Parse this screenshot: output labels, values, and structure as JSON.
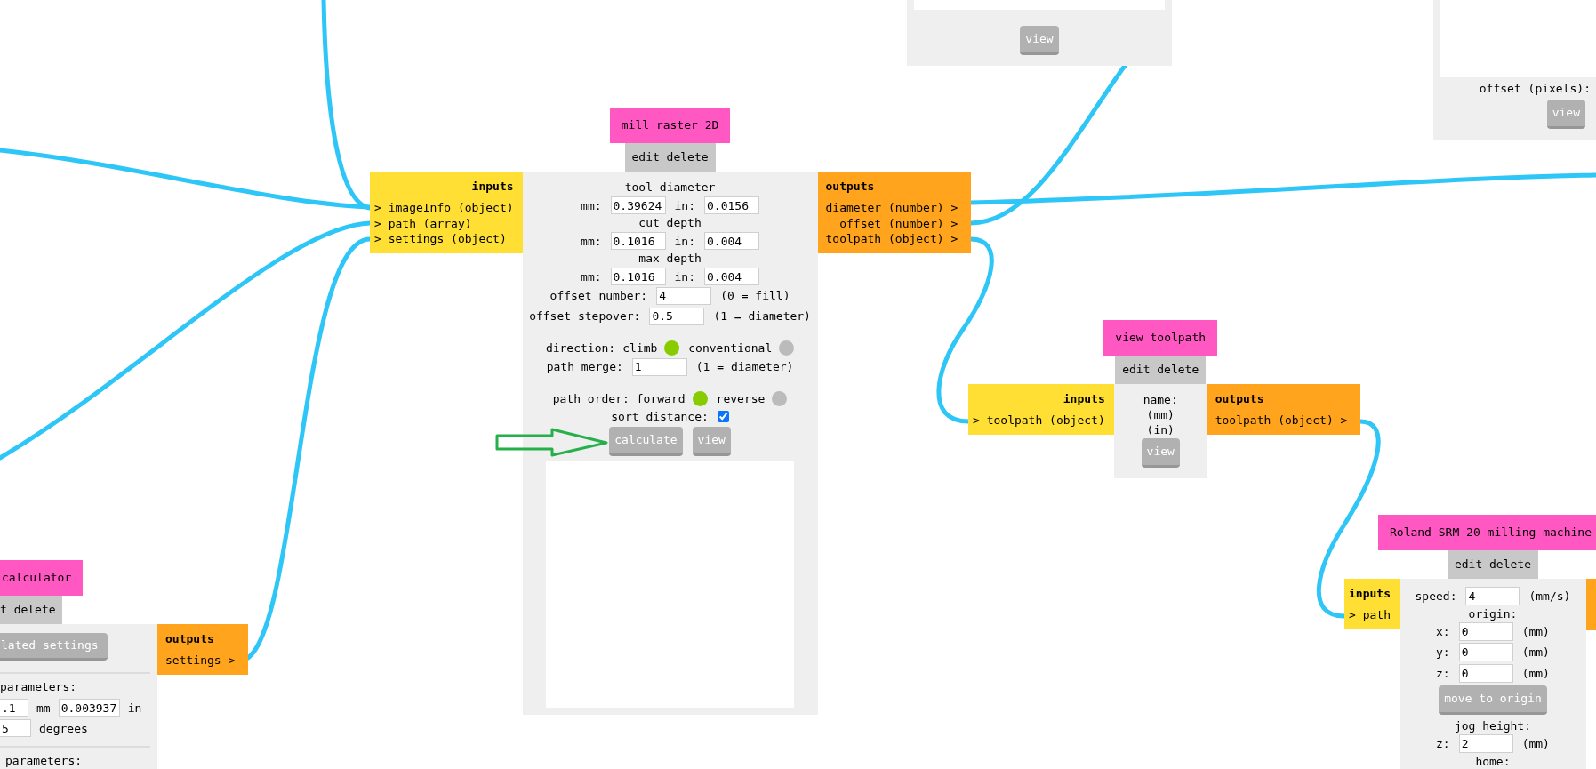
{
  "top_preview_node": {
    "buttons": [
      "view"
    ]
  },
  "offset_node": {
    "label": "offset (pixels):",
    "buttons": [
      "view"
    ]
  },
  "mill_raster_node": {
    "title": "mill raster 2D",
    "menu": [
      "edit",
      "delete"
    ],
    "inputs": {
      "title": "inputs",
      "ports": [
        "> imageInfo (object)",
        "> path (array)",
        "> settings (object)"
      ]
    },
    "outputs": {
      "title": "outputs",
      "ports": [
        "diameter (number) >",
        "offset (number) >",
        "toolpath (object) >"
      ]
    },
    "params": [
      {
        "kind": "heading",
        "text": "tool diameter"
      },
      {
        "kind": "pair",
        "fields": [
          {
            "label": "mm:",
            "value": "0.39624"
          },
          {
            "label": "in:",
            "value": "0.0156"
          }
        ]
      },
      {
        "kind": "heading",
        "text": "cut depth"
      },
      {
        "kind": "pair",
        "fields": [
          {
            "label": "mm:",
            "value": "0.1016"
          },
          {
            "label": "in:",
            "value": "0.004"
          }
        ]
      },
      {
        "kind": "heading",
        "text": "max depth"
      },
      {
        "kind": "pair",
        "fields": [
          {
            "label": "mm:",
            "value": "0.1016"
          },
          {
            "label": "in:",
            "value": "0.004"
          }
        ]
      },
      {
        "kind": "field",
        "label": "offset number:",
        "value": "4",
        "unit": "(0 = fill)"
      },
      {
        "kind": "field",
        "label": "offset stepover:",
        "value": "0.5",
        "unit": "(1 = diameter)"
      },
      {
        "kind": "radio",
        "label": "direction:",
        "options": [
          {
            "label": "climb",
            "selected": true
          },
          {
            "label": "conventional",
            "selected": false
          }
        ]
      },
      {
        "kind": "field",
        "label": "path merge:",
        "value": "1",
        "unit": "(1 = diameter)"
      },
      {
        "kind": "radio",
        "label": "path order:",
        "options": [
          {
            "label": "forward",
            "selected": true
          },
          {
            "label": "reverse",
            "selected": false
          }
        ]
      },
      {
        "kind": "checkbox",
        "label": "sort distance:",
        "checked": true
      }
    ],
    "buttons": [
      "calculate",
      "view"
    ]
  },
  "view_toolpath_node": {
    "title": "view toolpath",
    "menu": [
      "edit",
      "delete"
    ],
    "inputs": {
      "title": "inputs",
      "ports": [
        "> toolpath (object)"
      ]
    },
    "outputs": {
      "title": "outputs",
      "ports": [
        "toolpath (object) >"
      ]
    },
    "params": [
      {
        "kind": "heading",
        "text": "name:"
      },
      {
        "kind": "heading",
        "text": "(mm)"
      },
      {
        "kind": "heading",
        "text": "(in)"
      }
    ],
    "buttons": [
      "view"
    ]
  },
  "roland_node": {
    "title": "Roland SRM-20 milling machine",
    "menu": [
      "edit",
      "delete"
    ],
    "inputs": {
      "title": "inputs",
      "ports": [
        "> path"
      ]
    },
    "outputs_cut": true,
    "params": [
      {
        "kind": "field",
        "label": "speed:",
        "value": "4",
        "unit": "(mm/s)"
      },
      {
        "kind": "heading",
        "text": "origin:"
      },
      {
        "kind": "field",
        "label": "x:",
        "value": "0",
        "unit": "(mm)"
      },
      {
        "kind": "field",
        "label": "y:",
        "value": "0",
        "unit": "(mm)"
      },
      {
        "kind": "field",
        "label": "z:",
        "value": "0",
        "unit": "(mm)"
      },
      {
        "kind": "button",
        "label": "move to origin"
      },
      {
        "kind": "heading",
        "text": "jog height:"
      },
      {
        "kind": "field",
        "label": "z:",
        "value": "2",
        "unit": "(mm)"
      },
      {
        "kind": "heading",
        "text": "home:"
      }
    ]
  },
  "calculator_node": {
    "title": "calculator",
    "menu": [
      "t",
      "delete"
    ],
    "button": "lated settings",
    "sections": [
      {
        "heading": "parameters:",
        "rows": [
          {
            "fields": [
              {
                "value": ".1",
                "unit": "mm"
              },
              {
                "value": "0.003937",
                "unit": "in"
              }
            ]
          },
          {
            "fields": [
              {
                "value": "5",
                "unit": "degrees"
              }
            ]
          }
        ]
      },
      {
        "heading": "parameters:"
      }
    ],
    "outputs": {
      "title": "outputs",
      "ports": [
        "settings >"
      ]
    }
  }
}
